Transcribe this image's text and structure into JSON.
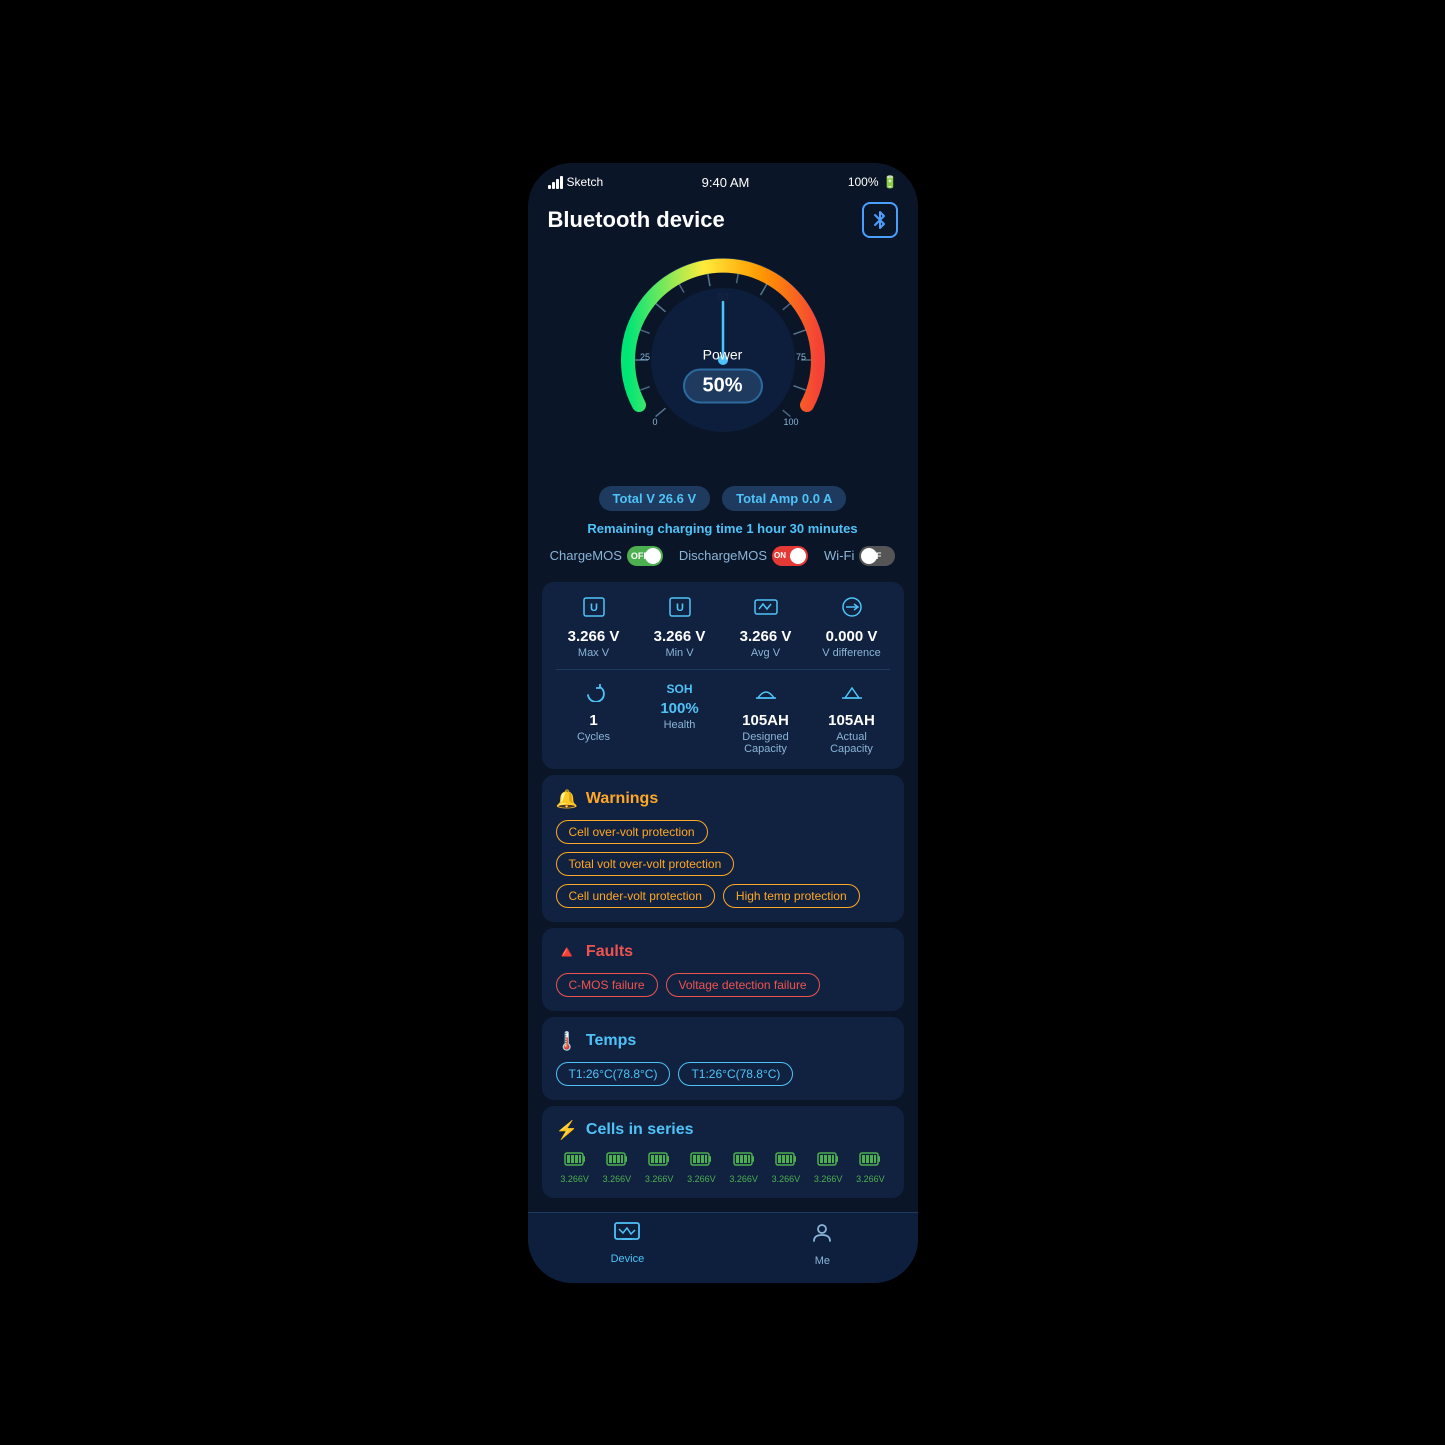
{
  "statusBar": {
    "carrier": "Sketch",
    "time": "9:40 AM",
    "battery": "100%"
  },
  "header": {
    "title": "Bluetooth device",
    "bluetoothIcon": "⚡"
  },
  "gauge": {
    "value": 50,
    "label": "Power",
    "percentLabel": "50%",
    "needle_angle": 0
  },
  "stats": {
    "totalVLabel": "Total V",
    "totalVValue": "26.6 V",
    "totalAmpLabel": "Total Amp",
    "totalAmpValue": "0.0 A",
    "chargingTimeLabel": "Remaining charging time",
    "chargingTimeValue": "1 hour 30 minutes"
  },
  "toggles": {
    "chargeMOS": {
      "label": "ChargeMOS",
      "state": "OFF",
      "color": "on-green"
    },
    "dischargeMOS": {
      "label": "DischargeMOS",
      "state": "ON",
      "color": "on-red"
    },
    "wifi": {
      "label": "Wi-Fi",
      "state": "OFF",
      "color": "off"
    }
  },
  "dataGrid": {
    "maxV": {
      "value": "3.266 V",
      "label": "Max V"
    },
    "minV": {
      "value": "3.266 V",
      "label": "Min V"
    },
    "avgV": {
      "value": "3.266 V",
      "label": "Avg V"
    },
    "vDiff": {
      "value": "0.000 V",
      "label": "V difference"
    },
    "cycles": {
      "value": "1",
      "label": "Cycles"
    },
    "soh": {
      "value": "100%",
      "label": "Health",
      "prefix": "SOH"
    },
    "designedCap": {
      "value": "105AH",
      "label": "Designed Capacity"
    },
    "actualCap": {
      "value": "105AH",
      "label": "Actual Capacity"
    }
  },
  "warnings": {
    "title": "Warnings",
    "tags": [
      "Cell over-volt protection",
      "Total volt over-volt protection",
      "Cell under-volt protection",
      "High temp protection"
    ]
  },
  "faults": {
    "title": "Faults",
    "tags": [
      "C-MOS failure",
      "Voltage detection failure"
    ]
  },
  "temps": {
    "title": "Temps",
    "tags": [
      "T1:26°C(78.8°C)",
      "T1:26°C(78.8°C)"
    ]
  },
  "cells": {
    "title": "Cells in series",
    "values": [
      "3.266V",
      "3.266V",
      "3.266V",
      "3.266V",
      "3.266V",
      "3.266V",
      "3.266V",
      "3.266V"
    ]
  },
  "bottomNav": {
    "items": [
      {
        "icon": "📊",
        "label": "Device",
        "active": true
      },
      {
        "icon": "👤",
        "label": "Me",
        "active": false
      }
    ]
  }
}
